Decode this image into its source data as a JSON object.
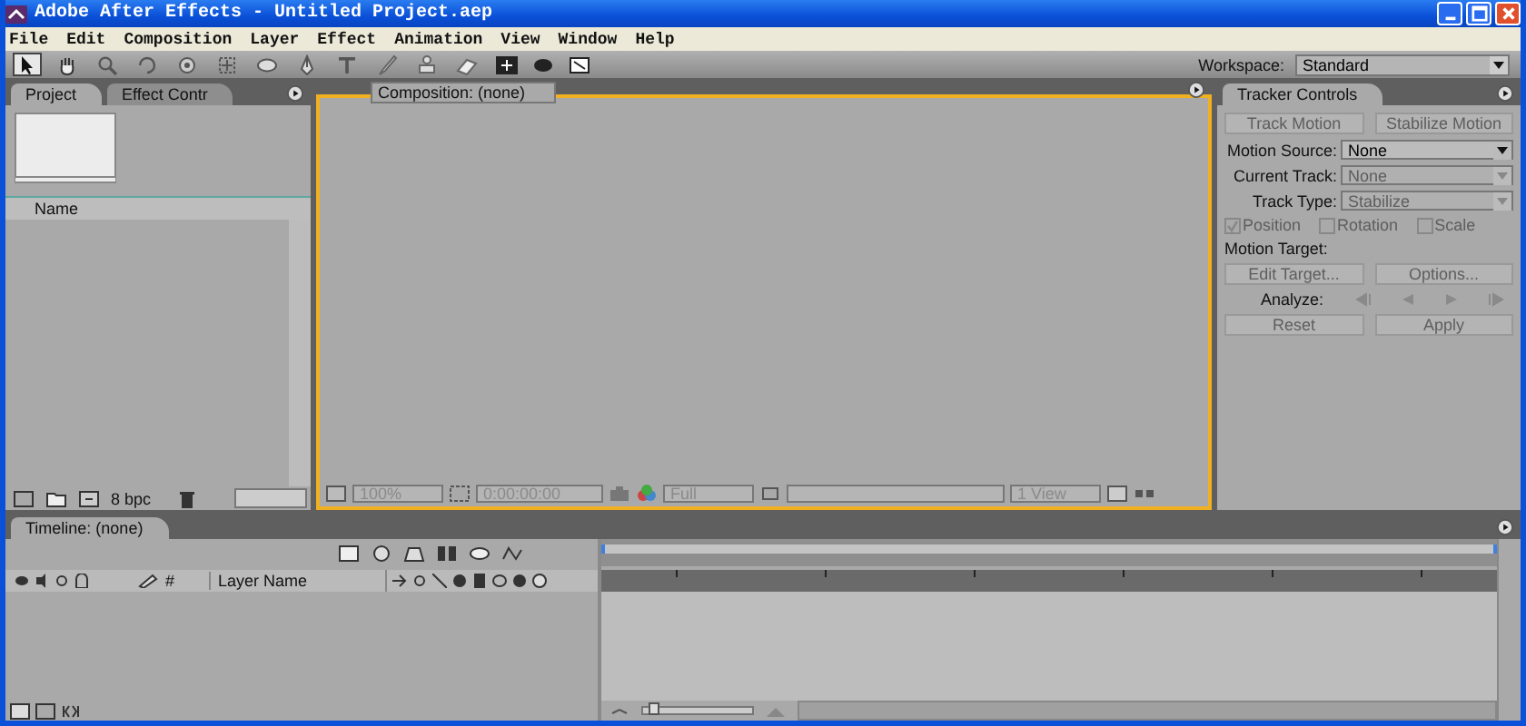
{
  "window": {
    "title": "Adobe After Effects - Untitled Project.aep"
  },
  "menu": [
    "File",
    "Edit",
    "Composition",
    "Layer",
    "Effect",
    "Animation",
    "View",
    "Window",
    "Help"
  ],
  "tools": [
    {
      "kind": "selection",
      "selected": true
    },
    {
      "kind": "hand",
      "selected": false
    },
    {
      "kind": "zoom",
      "selected": false
    },
    {
      "kind": "rotate",
      "selected": false
    },
    {
      "kind": "orbit",
      "selected": false
    },
    {
      "kind": "pan",
      "selected": false
    },
    {
      "kind": "ellipse",
      "selected": false
    },
    {
      "kind": "pen",
      "selected": false
    },
    {
      "kind": "text",
      "selected": false
    },
    {
      "kind": "brush",
      "selected": false
    },
    {
      "kind": "stamp",
      "selected": false
    },
    {
      "kind": "eraser",
      "selected": false
    }
  ],
  "workspace": {
    "label": "Workspace:",
    "value": "Standard"
  },
  "project_panel": {
    "tabs": [
      {
        "label": "Project",
        "selected": true
      },
      {
        "label": "Effect Contr",
        "selected": false
      }
    ],
    "column": "Name",
    "depth": "8 bpc"
  },
  "composition_panel": {
    "tab": "Composition: (none)",
    "zoom": "100%",
    "timecode": "0:00:00:00",
    "resolution": "Full",
    "view": "1 View"
  },
  "tracker_panel": {
    "title": "Tracker Controls",
    "top_buttons": [
      {
        "label": "Track Motion",
        "disabled": true
      },
      {
        "label": "Stabilize Motion",
        "disabled": true
      }
    ],
    "fields": [
      {
        "label": "Motion Source:",
        "value": "None",
        "disabled": false
      },
      {
        "label": "Current Track:",
        "value": "None",
        "disabled": true
      },
      {
        "label": "Track Type:",
        "value": "Stabilize",
        "disabled": true
      }
    ],
    "options": [
      {
        "label": "Position",
        "checked": true,
        "disabled": true
      },
      {
        "label": "Rotation",
        "checked": false,
        "disabled": true
      },
      {
        "label": "Scale",
        "checked": false,
        "disabled": true
      }
    ],
    "target_label": "Motion Target:",
    "target_buttons": [
      {
        "label": "Edit Target...",
        "disabled": true
      },
      {
        "label": "Options...",
        "disabled": true
      }
    ],
    "analyze_label": "Analyze:",
    "bottom_buttons": [
      {
        "label": "Reset",
        "disabled": true
      },
      {
        "label": "Apply",
        "disabled": true
      }
    ]
  },
  "timeline": {
    "tab": "Timeline: (none)",
    "columns": [
      "#",
      "Layer Name"
    ],
    "zoom_slider": {
      "level": 0.1
    }
  }
}
